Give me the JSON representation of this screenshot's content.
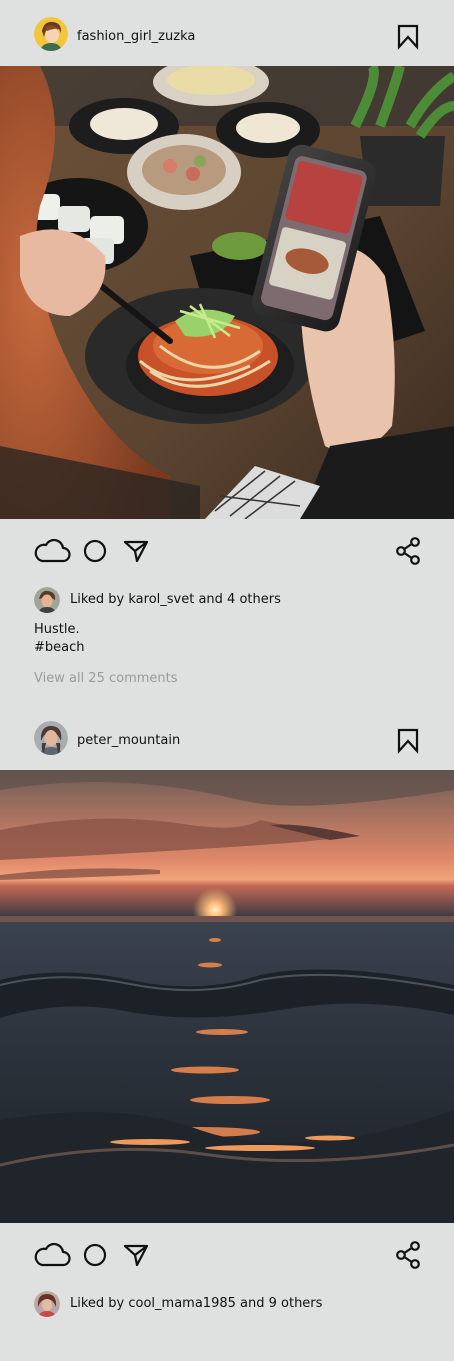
{
  "posts": [
    {
      "username": "fashion_girl_zuzka",
      "likes_text": "Liked by karol_svet and 4 others",
      "caption_line1": "Hustle.",
      "caption_line2": "#beach",
      "comments_link": "View all 25 comments"
    },
    {
      "username": "peter_mountain",
      "likes_text": "Liked by cool_mama1985 and 9 others"
    }
  ],
  "icons": {
    "like": "cloud-icon",
    "comment": "circle-icon",
    "send": "send-icon",
    "share": "share-icon",
    "save": "bookmark-icon"
  },
  "colors": {
    "background": "#dfe1e0",
    "text": "#111111",
    "muted": "#9a9a9a"
  }
}
